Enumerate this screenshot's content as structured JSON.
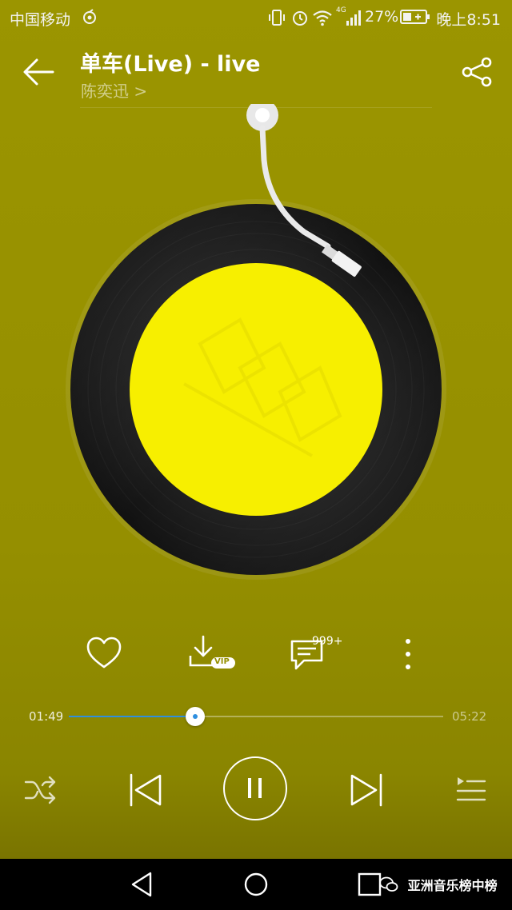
{
  "status_bar": {
    "carrier": "中国移动",
    "network": "4G",
    "battery_percent": "27%",
    "time": "晚上8:51"
  },
  "header": {
    "title": "单车(Live) - live",
    "artist": "陈奕迅 >"
  },
  "actions": {
    "comment_count": "999+",
    "download_badge": "VIP"
  },
  "progress": {
    "current": "01:49",
    "total": "05:22",
    "fraction": 0.3385,
    "fill_color": "#2e8fe0"
  },
  "player": {
    "state": "playing"
  },
  "watermark": {
    "text": "亚洲音乐榜中榜"
  },
  "colors": {
    "background": "#969000",
    "label": "#f7ef00"
  }
}
